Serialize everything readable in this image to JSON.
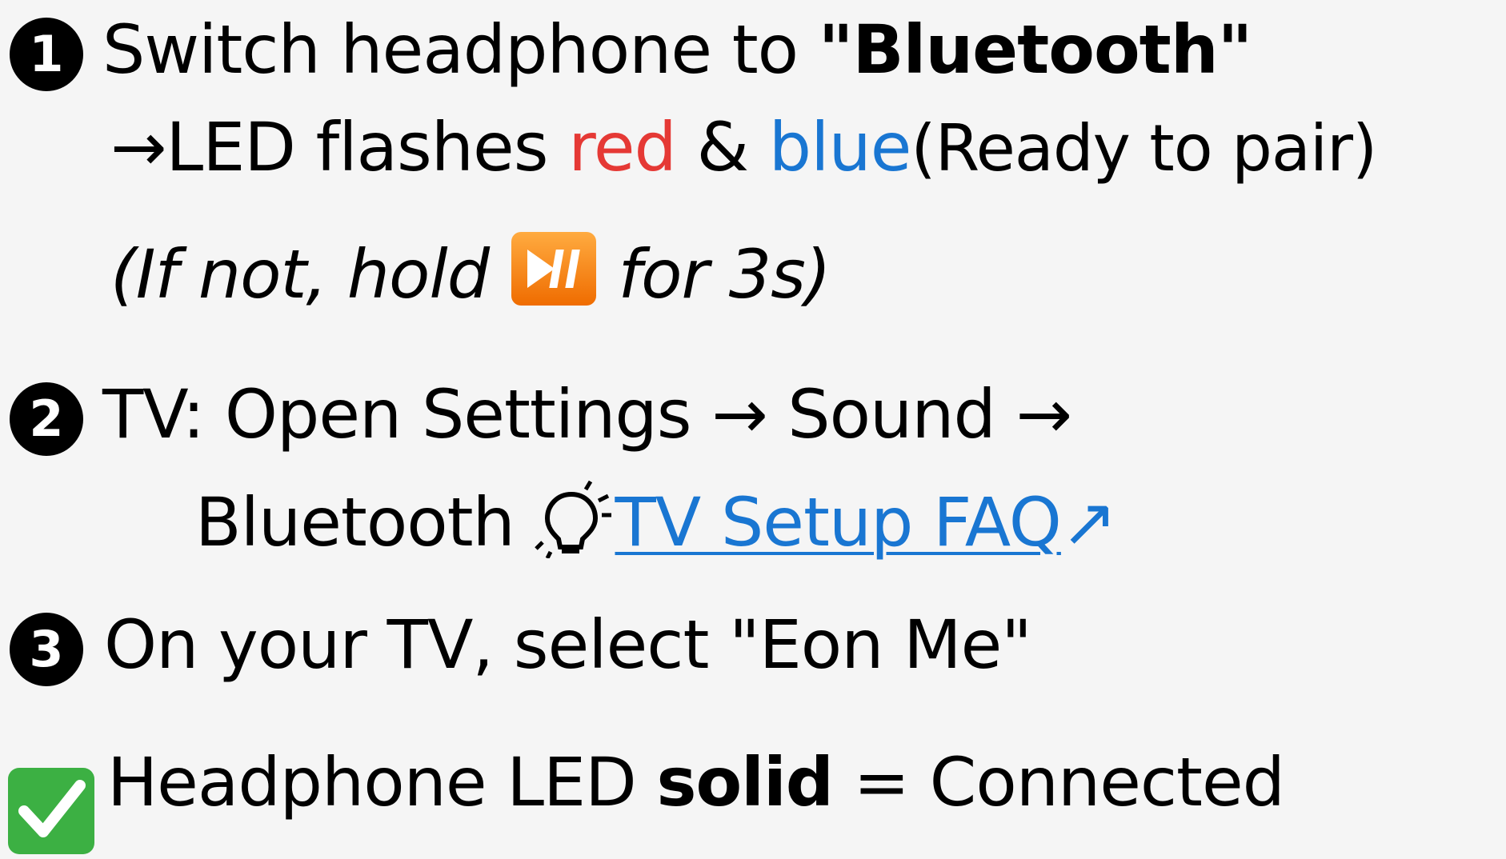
{
  "step1": {
    "number": "1",
    "text_before": "Switch headphone to ",
    "text_bold": "\"Bluetooth\"",
    "arrow": "→",
    "led_text": "LED flashes ",
    "red_word": "red",
    "amp": " & ",
    "blue_word": "blue",
    "ready_note": "(Ready to pair)",
    "hint_open": "(",
    "hint_before": "If not, hold ",
    "hint_after": " for 3s",
    "hint_close": ")",
    "icon": "play-pause-icon"
  },
  "step2": {
    "number": "2",
    "line1": "TV: Open Settings → Sound →",
    "line2": "Bluetooth ",
    "icon": "lightbulb-icon",
    "link_label": "TV Setup FAQ",
    "link_arrow": "↗"
  },
  "step3": {
    "number": "3",
    "text": "On your TV, select \"Eon Me\""
  },
  "result": {
    "icon": "check-mark-icon",
    "text_before": "Headphone LED ",
    "text_bold": "solid",
    "text_after": " = Connected"
  },
  "colors": {
    "background": "#f5f5f5",
    "red": "#e53935",
    "blue": "#1976d2",
    "check_green": "#3cb043",
    "play_orange": "#f57c00"
  }
}
